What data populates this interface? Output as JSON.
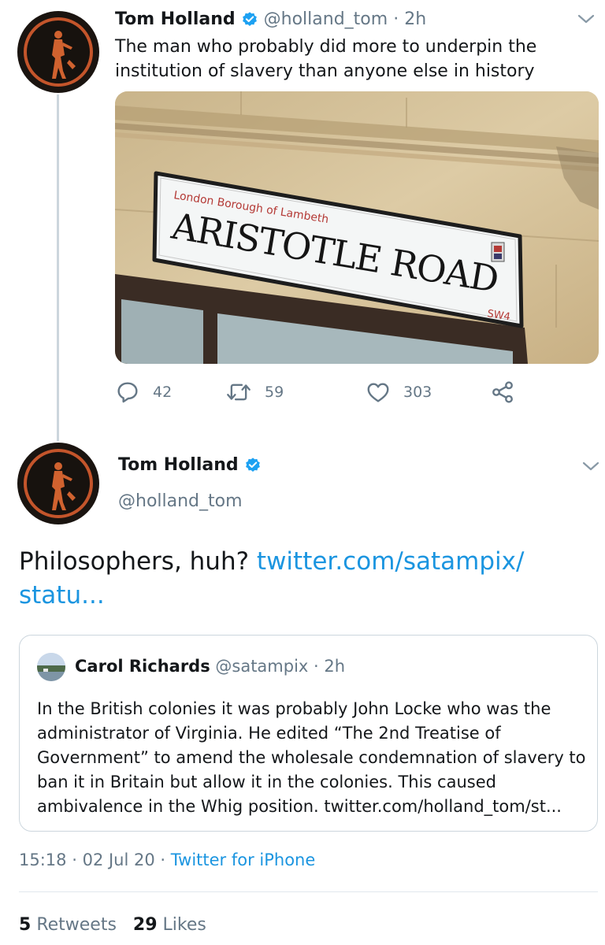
{
  "parent_tweet": {
    "author_name": "Tom Holland",
    "author_handle": "@holland_tom",
    "separator": "·",
    "time_ago": "2h",
    "text": "The man who probably did more to underpin the institution of slavery than anyone else in history",
    "photo": {
      "sign_borough": "London Borough of Lambeth",
      "sign_street": "ARISTOTLE ROAD",
      "sign_postcode": "SW4"
    },
    "reply_count": "42",
    "retweet_count": "59",
    "like_count": "303"
  },
  "main_tweet": {
    "author_name": "Tom Holland",
    "author_handle": "@holland_tom",
    "text": "Philosophers, huh?",
    "link_line1": "twitter.com/satampix/",
    "link_line2": "statu...",
    "quoted": {
      "author_name": "Carol Richards",
      "author_handle": "@satampix",
      "separator": "·",
      "time_ago": "2h",
      "text": "In the British colonies it was probably John Locke who was the administrator of Virginia. He edited “The 2nd Treatise of Government” to amend the wholesale condemnation of slavery to ban it in Britain but allow it in the colonies. This caused ambivalence in the Whig position. twitter.com/holland_tom/st..."
    },
    "time": "15:18",
    "date": "02 Jul 20",
    "separator": "·",
    "source": "Twitter for iPhone",
    "retweets_count": "5",
    "retweets_label": "Retweets",
    "likes_count": "29",
    "likes_label": "Likes"
  },
  "colors": {
    "link": "#1b95e0",
    "secondary_text": "#657786",
    "verified": "#1da1f2",
    "border": "#ccd6dd"
  },
  "icons": [
    "verified-badge-icon",
    "chevron-down-icon",
    "reply-icon",
    "retweet-icon",
    "like-icon",
    "share-icon"
  ]
}
